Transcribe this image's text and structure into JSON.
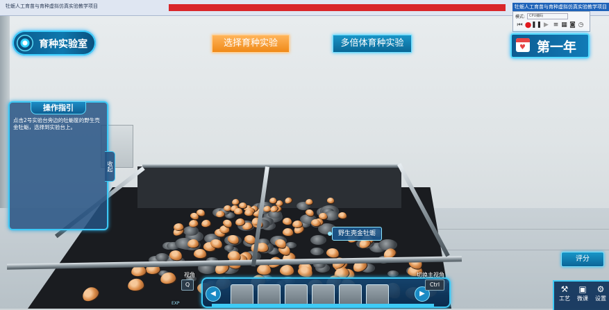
{
  "window": {
    "title": "牡蛎人工育苗与育种虚拟仿真实验教学项目",
    "title_right": "牡蛎人工育苗与育种虚拟仿真实验教学项目"
  },
  "recorder": {
    "label": "模式:",
    "mode": "CPU编码"
  },
  "hud": {
    "lab_name": "育种实验室",
    "select_experiment_label": "选择育种实验",
    "multiploid_experiment_label": "多倍体育种实验",
    "year_label": "第一年"
  },
  "guide": {
    "title": "操作指引",
    "text": "点击2号实验台旁边的牡蛎筐的野生壳金牡蛎，选择到实验台上。",
    "collapse_label": "收起"
  },
  "scene": {
    "species_label": "野生壳金牡蛎"
  },
  "toolbar": {
    "view_label": "视角",
    "view_key": "Q",
    "switch_label": "切换主视角",
    "switch_key": "Ctrl",
    "exp_label": "EXP"
  },
  "side": {
    "score_label": "评分",
    "tools": [
      {
        "icon": "craft-icon",
        "glyph": "⚒",
        "label": "工艺"
      },
      {
        "icon": "microlesson-icon",
        "glyph": "▣",
        "label": "微课"
      },
      {
        "icon": "settings-icon",
        "glyph": "⚙",
        "label": "设置"
      }
    ]
  },
  "colors": {
    "accent_cyan": "#3cc8f5",
    "active_orange": "#f08a18",
    "panel_blue": "#0d5c92"
  }
}
